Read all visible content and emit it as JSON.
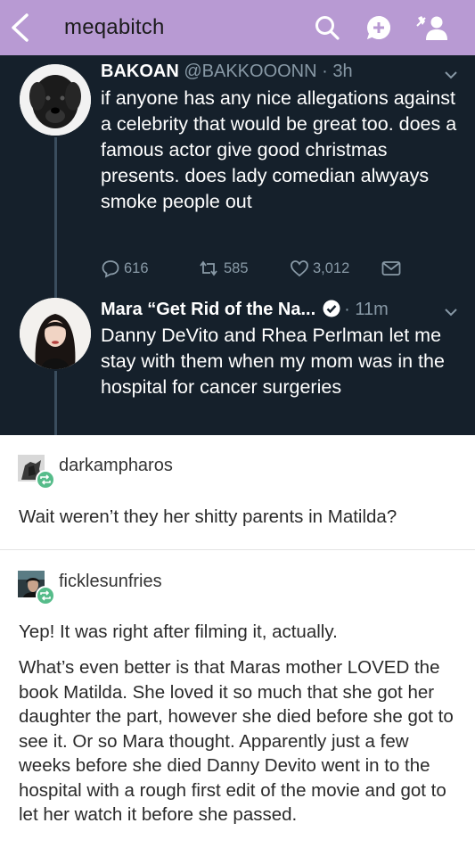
{
  "topbar": {
    "blog_name": "meqabitch",
    "background": "#b89ad3",
    "icons": [
      "back-chevron-icon",
      "search-icon",
      "compose-icon",
      "follow-icon"
    ]
  },
  "tweet1": {
    "display_name": "BAKOAN",
    "handle_time": "@BAKKOOONN · 3h",
    "text": "if anyone has any nice allegations against a celebrity that would be great too. does a famous actor give good christmas presents. does lady comedian alwyays smoke people out",
    "replies": "616",
    "retweets": "585",
    "likes": "3,012"
  },
  "tweet2": {
    "display_name": "Mara “Get Rid of the Na...",
    "time": "· 11m",
    "text": "Danny DeVito and Rhea Perlman let me stay with them when my mom was in the hospital for cancer surgeries"
  },
  "reblog1": {
    "username": "darkampharos",
    "text": "Wait weren’t they her shitty parents in Matilda?"
  },
  "reblog2": {
    "username": "ficklesunfries",
    "text1": "Yep! It was right after filming it, actually.",
    "text2": "What’s even better is that Maras mother LOVED the book Matilda. She loved it so much that she got her daughter the part, however she died before she got to see it. Or so Mara thought. Apparently just a few weeks before she died Danny Devito went in to the hospital with a rough first edit of the movie and got to let her watch it before she passed."
  },
  "colors": {
    "tweet_bg": "#15202b",
    "muted": "#8899a6",
    "reblog_green": "#56bc8a",
    "verified_blue": "#1da1f2"
  }
}
